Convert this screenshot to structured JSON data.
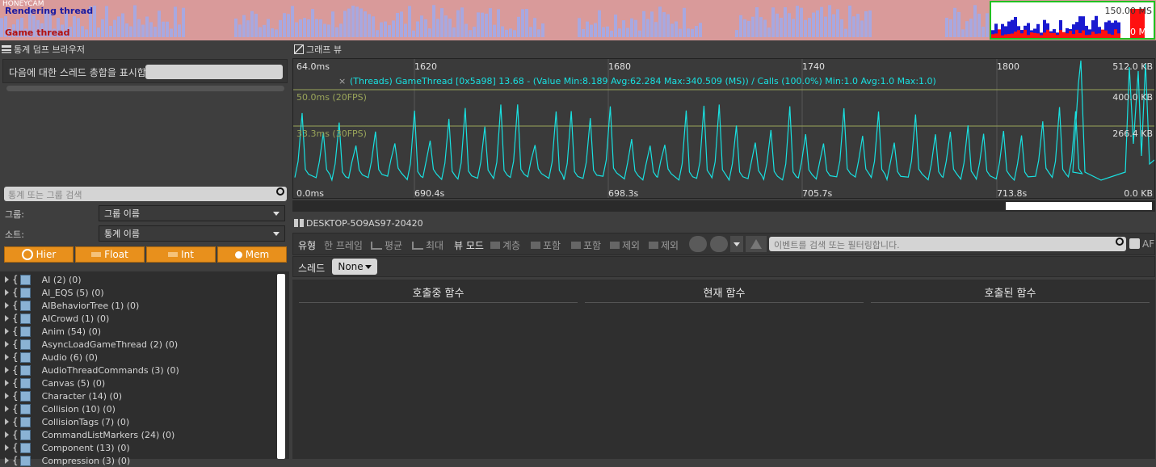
{
  "minimap": {
    "rendering_label": "Rendering thread",
    "game_label": "Game thread",
    "watermark": "HONEYCAM",
    "max_label": "150.00 MS",
    "min_label": "0.0 MS"
  },
  "stats_browser": {
    "title": "통계 덤프 브라우저",
    "thread_prompt": "다음에 대한 스레드 총합을 표시합",
    "search_placeholder": "통계 또는 그룹 검색",
    "group_label": "그룹:",
    "group_value": "그룹 이름",
    "sort_label": "소트:",
    "sort_value": "통계 이름",
    "buttons": [
      "Hier",
      "Float",
      "Int",
      "Mem"
    ],
    "groups": [
      "AI (2) (0)",
      "AI_EQS (5) (0)",
      "AIBehaviorTree (1) (0)",
      "AICrowd (1) (0)",
      "Anim (54) (0)",
      "AsyncLoadGameThread (2) (0)",
      "Audio (6) (0)",
      "AudioThreadCommands (3) (0)",
      "Canvas (5) (0)",
      "Character (14) (0)",
      "Collision (10) (0)",
      "CollisionTags (7) (0)",
      "CommandListMarkers (24) (0)",
      "Component (13) (0)",
      "Compression (3) (0)"
    ]
  },
  "graph_view": {
    "title": "그래프 뷰",
    "top_left": "64.0ms",
    "x_frames": [
      "1620",
      "1680",
      "1740",
      "1800"
    ],
    "x_times": [
      "690.4s",
      "698.3s",
      "705.7s",
      "713.8s"
    ],
    "bottom_left": "0.0ms",
    "fps_lines": [
      "50.0ms (20FPS)",
      "33.3ms (30FPS)"
    ],
    "right_labels": [
      "512.0 KB",
      "400.0 KB",
      "266.4 KB",
      "0.0 KB"
    ],
    "series_caption": "(Threads) GameThread [0x5a98] 13.68 - (Value Min:8.189 Avg:62.284 Max:340.509 (MS)) / Calls (100.0%) Min:1.0 Avg:1.0 Max:1.0)",
    "close_glyph": "×"
  },
  "event_panel": {
    "title": "DESKTOP-5O9AS97-20420",
    "type_label": "유형",
    "type_items": [
      "한 프레임",
      "평균",
      "최대"
    ],
    "view_mode_label": "뷰 모드",
    "view_items": [
      "계층",
      "포함",
      "포함",
      "제외",
      "제외"
    ],
    "search_placeholder": "이벤트를 검색 또는 필터링합니다.",
    "af_label": "AF",
    "thread_label": "스레드",
    "thread_value": "None",
    "columns": [
      "호출중 함수",
      "현재 함수",
      "호출된 함수"
    ]
  },
  "colors": {
    "accent": "#e8901c",
    "graph_line": "#19e0e0",
    "fps_line": "#9aa55a",
    "mini_bg": "#d99a9a",
    "mini_bars": "#a8a8e0"
  }
}
